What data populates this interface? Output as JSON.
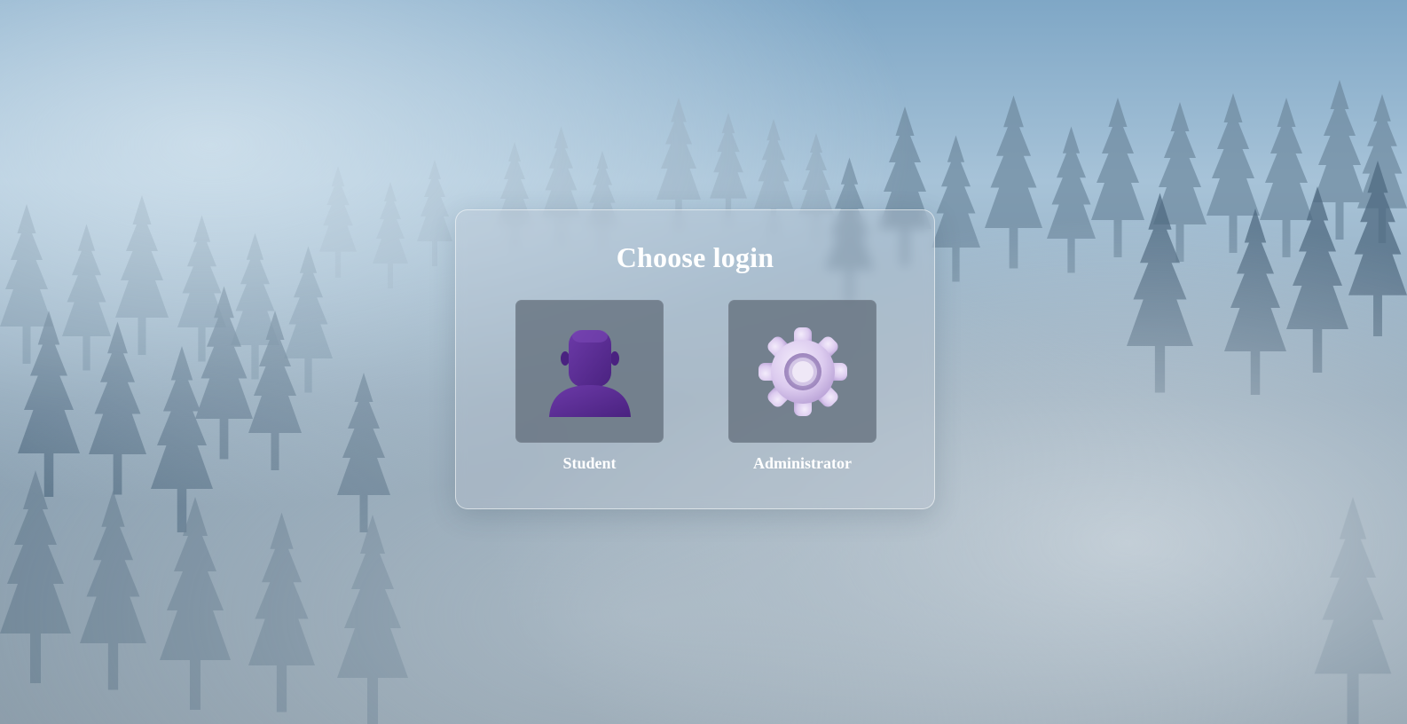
{
  "page": {
    "title": "Choose login"
  },
  "options": [
    {
      "label": "Student",
      "icon": "student-user-icon",
      "icon_color": "#5b2d91"
    },
    {
      "label": "Administrator",
      "icon": "gear-icon",
      "icon_color": "#d9c8ec"
    }
  ],
  "colors": {
    "panel_border": "#ffffff",
    "title_text": "#ffffff",
    "tile_background": "#66707c"
  }
}
